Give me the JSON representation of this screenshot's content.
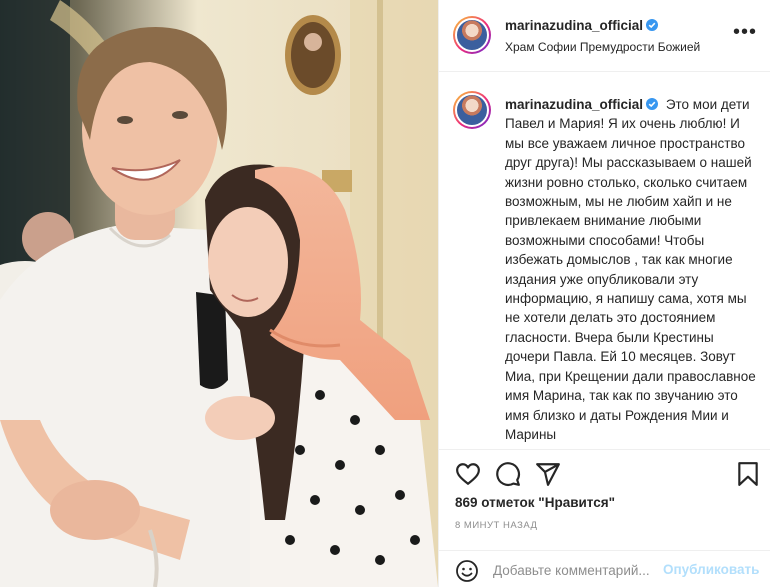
{
  "post": {
    "username": "marinazudina_official",
    "location": "Храм Софии Премудрости Божией",
    "caption": "Это мои дети Павел и Мария! Я их очень люблю! И мы все уважаем личное пространство друг друга)! Мы рассказываем о нашей жизни ровно столько, сколько считаем возможным, мы не любим хайп и не привлекаем внимание любыми возможными способами! Чтобы избежать домыслов , так как многие издания уже опубликовали эту информацию, я напишу сама, хотя мы не хотели делать это достоянием гласности. Вчера были Крестины дочери Павла. Ей 10 месяцев. Зовут Миа, при Крещении дали православное имя Марина, так как по звучанию это имя близко и даты Рождения Мии и Марины",
    "likes": "869 отметок \"Нравится\"",
    "time": "8 МИНУТ НАЗАД"
  },
  "comment": {
    "placeholder": "Добавьте комментарий...",
    "publish_label": "Опубликовать"
  },
  "icons": {
    "more": "more-options-icon",
    "like": "heart-icon",
    "comment": "comment-icon",
    "share": "share-icon",
    "save": "bookmark-icon",
    "emoji": "emoji-icon",
    "verified": "verified-badge-icon"
  },
  "colors": {
    "verified": "#3897f0",
    "publish_disabled": "#b2dffc",
    "secondary_text": "#8e8e8e",
    "divider": "#efefef"
  }
}
